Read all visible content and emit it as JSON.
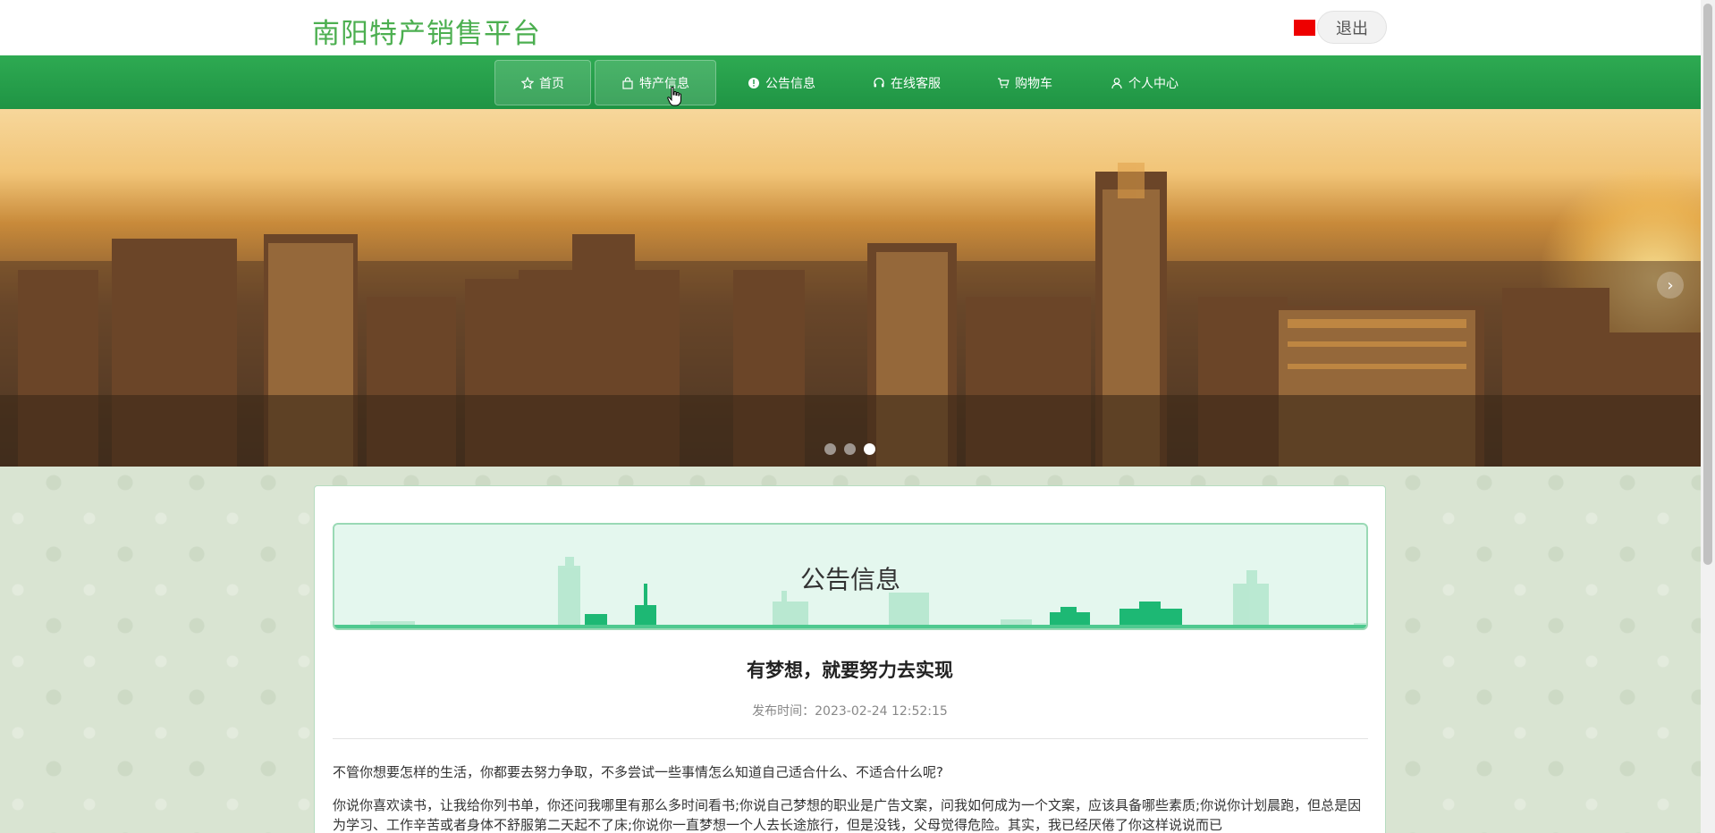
{
  "header": {
    "site_title": "南阳特产销售平台",
    "logout_label": "退出"
  },
  "nav": {
    "items": [
      {
        "label": "首页",
        "icon": "star-icon"
      },
      {
        "label": "特产信息",
        "icon": "bag-icon"
      },
      {
        "label": "公告信息",
        "icon": "info-icon"
      },
      {
        "label": "在线客服",
        "icon": "headset-icon"
      },
      {
        "label": "购物车",
        "icon": "cart-icon"
      },
      {
        "label": "个人中心",
        "icon": "user-icon"
      }
    ]
  },
  "banner": {
    "next_arrow": "›",
    "dot_count": 3,
    "active_index": 2
  },
  "content": {
    "section_title": "公告信息",
    "article_title": "有梦想，就要努力去实现",
    "publish_label": "发布时间：",
    "publish_time": "2023-02-24 12:52:15",
    "paragraph1": "不管你想要怎样的生活，你都要去努力争取，不多尝试一些事情怎么知道自己适合什么、不适合什么呢?",
    "paragraph2": "你说你喜欢读书，让我给你列书单，你还问我哪里有那么多时间看书;你说自己梦想的职业是广告文案，问我如何成为一个文案，应该具备哪些素质;你说你计划晨跑，但总是因为学习、工作辛苦或者身体不舒服第二天起不了床;你说你一直梦想一个人去长途旅行，但是没钱，父母觉得危险。其实，我已经厌倦了你这样说说而已"
  },
  "colors": {
    "brand_green": "#4caf50",
    "nav_green": "#1f9444",
    "flag_red": "#ee0000"
  }
}
